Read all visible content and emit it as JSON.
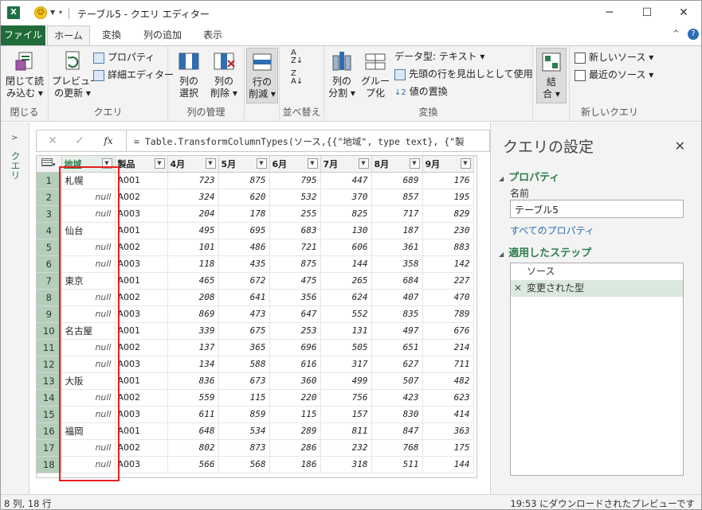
{
  "window": {
    "title": "テーブル5 - クエリ エディター",
    "min_glyph": "─",
    "max_glyph": "☐",
    "close_glyph": "✕"
  },
  "tabs": {
    "file": "ファイル",
    "items": [
      "ホーム",
      "変換",
      "列の追加",
      "表示"
    ]
  },
  "ribbon": {
    "close_load": "閉じて読み込む",
    "close_load_line1": "閉じて読",
    "close_load_line2": "み込む ▾",
    "preview_refresh_line1": "プレビュー",
    "preview_refresh_line2": "の更新 ▾",
    "properties": "プロパティ",
    "advanced_editor": "詳細エディター",
    "choose_cols_line1": "列の",
    "choose_cols_line2": "選択",
    "remove_cols_line1": "列の",
    "remove_cols_line2": "削除 ▾",
    "reduce_rows_line1": "行の",
    "reduce_rows_line2": "削減 ▾",
    "split_col_line1": "列の",
    "split_col_line2": "分割 ▾",
    "group_by_line1": "グルー",
    "group_by_line2": "プ化",
    "data_type": "データ型: テキスト ▾",
    "first_row_header": "先頭の行を見出しとして使用 ▾",
    "replace_values": "値の置換",
    "combine_line1": "結",
    "combine_line2": "合 ▾",
    "new_source": "新しいソース ▾",
    "recent_sources": "最近のソース ▾",
    "groups": {
      "close": "閉じる",
      "query": "クエリ",
      "manage_cols": "列の管理",
      "sort": "並べ替え",
      "transform": "変換",
      "new_query": "新しいクエリ"
    }
  },
  "queries_panel": {
    "label": "クエリ"
  },
  "formula_bar": {
    "cancel": "✕",
    "confirm": "✓",
    "fx": "fx",
    "formula": "= Table.TransformColumnTypes(ソース,{{\"地域\", type text}, {\"製"
  },
  "grid": {
    "columns": [
      "地域",
      "製品",
      "4月",
      "5月",
      "6月",
      "7月",
      "8月",
      "9月"
    ],
    "rows": [
      [
        "1",
        "札幌",
        "A001",
        "723",
        "875",
        "795",
        "447",
        "689",
        "176"
      ],
      [
        "2",
        "null",
        "A002",
        "324",
        "620",
        "532",
        "370",
        "857",
        "195"
      ],
      [
        "3",
        "null",
        "A003",
        "204",
        "178",
        "255",
        "825",
        "717",
        "829"
      ],
      [
        "4",
        "仙台",
        "A001",
        "495",
        "695",
        "683",
        "130",
        "187",
        "230"
      ],
      [
        "5",
        "null",
        "A002",
        "101",
        "486",
        "721",
        "606",
        "361",
        "883"
      ],
      [
        "6",
        "null",
        "A003",
        "118",
        "435",
        "875",
        "144",
        "358",
        "142"
      ],
      [
        "7",
        "東京",
        "A001",
        "465",
        "672",
        "475",
        "265",
        "684",
        "227"
      ],
      [
        "8",
        "null",
        "A002",
        "208",
        "641",
        "356",
        "624",
        "407",
        "470"
      ],
      [
        "9",
        "null",
        "A003",
        "869",
        "473",
        "647",
        "552",
        "835",
        "789"
      ],
      [
        "10",
        "名古屋",
        "A001",
        "339",
        "675",
        "253",
        "131",
        "497",
        "676"
      ],
      [
        "11",
        "null",
        "A002",
        "137",
        "365",
        "696",
        "505",
        "651",
        "214"
      ],
      [
        "12",
        "null",
        "A003",
        "134",
        "588",
        "616",
        "317",
        "627",
        "711"
      ],
      [
        "13",
        "大阪",
        "A001",
        "836",
        "673",
        "360",
        "499",
        "507",
        "482"
      ],
      [
        "14",
        "null",
        "A002",
        "559",
        "115",
        "220",
        "756",
        "423",
        "623"
      ],
      [
        "15",
        "null",
        "A003",
        "611",
        "859",
        "115",
        "157",
        "830",
        "414"
      ],
      [
        "16",
        "福岡",
        "A001",
        "648",
        "534",
        "289",
        "811",
        "847",
        "363"
      ],
      [
        "17",
        "null",
        "A002",
        "802",
        "873",
        "286",
        "232",
        "768",
        "175"
      ],
      [
        "18",
        "null",
        "A003",
        "566",
        "568",
        "186",
        "318",
        "511",
        "144"
      ]
    ]
  },
  "settings": {
    "title": "クエリの設定",
    "properties_heading": "プロパティ",
    "name_label": "名前",
    "name_value": "テーブル5",
    "all_properties": "すべてのプロパティ",
    "steps_heading": "適用したステップ",
    "steps": [
      "ソース",
      "変更された型"
    ]
  },
  "status": {
    "left": "8 列, 18 行",
    "right": "19:53 にダウンロードされたプレビューです"
  },
  "colors": {
    "accent_green": "#1f6b39",
    "highlight_red": "#e52020"
  }
}
